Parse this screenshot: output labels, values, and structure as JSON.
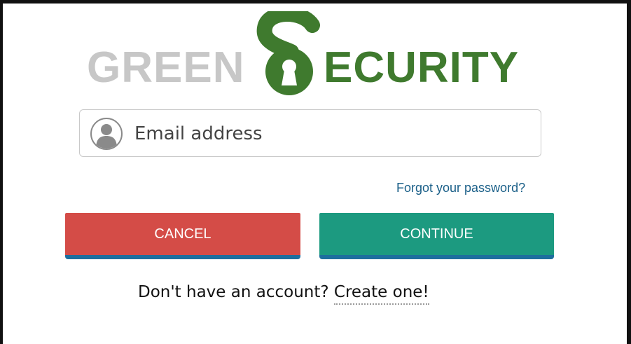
{
  "logo": {
    "part1": "GREEN",
    "part2": "ECURITY"
  },
  "email": {
    "placeholder": "Email address",
    "value": ""
  },
  "forgot": {
    "label": "Forgot your password?"
  },
  "buttons": {
    "cancel_label": "CANCEL",
    "continue_label": "CONTINUE"
  },
  "signup": {
    "prompt": "Don't have an account?",
    "link": "Create one!"
  },
  "colors": {
    "logo_gray": "#c7c7c7",
    "logo_green": "#3f7a2e",
    "cancel": "#d44c47",
    "continue": "#1c9a80",
    "button_underline": "#1d6e9e",
    "link": "#1a5f88"
  },
  "icons": {
    "logo_emblem": "keyhole-s-icon",
    "field_icon": "user-icon"
  }
}
